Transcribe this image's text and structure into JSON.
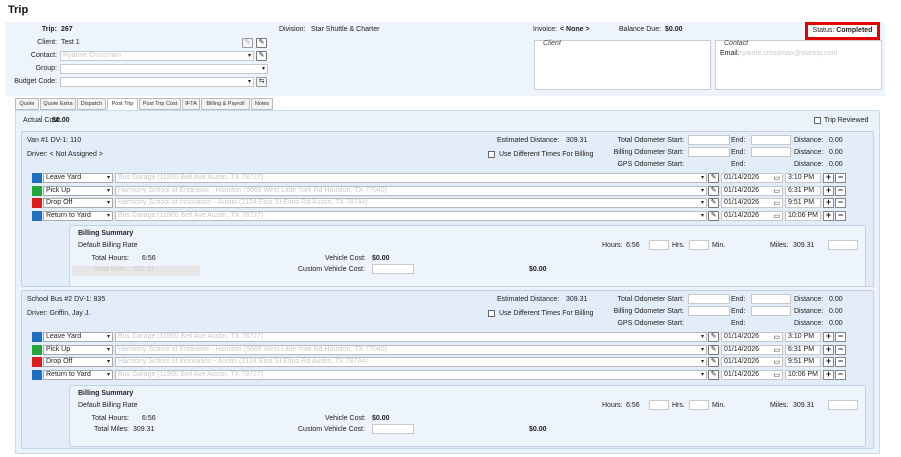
{
  "page": {
    "title": "Trip"
  },
  "header": {
    "trip_label": "Trip:",
    "trip_value": "267",
    "client_label": "Client:",
    "client_value": "Test 1",
    "contact_label": "Contact:",
    "contact_value": "Ryanne Crossman",
    "group_label": "Group:",
    "budget_label": "Budget Code:",
    "division_label": "Division:",
    "division_value": "Star Shuttle & Charter",
    "invoice_label": "Invoice:",
    "invoice_value": "< None >",
    "balance_label": "Balance Due:",
    "balance_value": "$0.00",
    "client_box_label": "Client",
    "contact_box_label": "Contact",
    "email_label": "Email:",
    "email_value": "ryanne.crossman@startrip.com",
    "status_label": "Status:",
    "status_value": "Completed"
  },
  "tabs": [
    "Quote",
    "Quote Extra",
    "Dispatch",
    "Post Trip",
    "Post Trip Cost",
    "IFTA",
    "Billing & Payroll",
    "Notes"
  ],
  "active_tab": "Post Trip",
  "post_trip": {
    "actual_cost_label": "Actual Cost:",
    "actual_cost_value": "$0.00",
    "trip_reviewed_label": "Trip Reviewed"
  },
  "labels": {
    "estimated_distance": "Estimated Distance:",
    "use_diff_times": "Use Different Times For Billing",
    "total_odo_start": "Total Odometer Start:",
    "billing_odo_start": "Billing Odometer Start:",
    "gps_odo_start": "GPS Odometer Start:",
    "end": "End:",
    "distance": "Distance:",
    "billing_summary": "Billing Summary",
    "hours": "Hours:",
    "hrs": "Hrs.",
    "min": "Min.",
    "miles": "Miles:",
    "total_hours": "Total Hours:",
    "total_miles": "Total Miles:",
    "vehicle_cost": "Vehicle Cost:",
    "custom_vehicle_cost": "Custom Vehicle Cost:"
  },
  "vehicles": [
    {
      "title": "Van #1 DV-1: 110",
      "driver": "Driver: < Not Assigned >",
      "estimated_distance": "309.31",
      "distance_total": "0.00",
      "distance_billing": "0.00",
      "distance_gps": "0.00",
      "stops": [
        {
          "type": "Leave Yard",
          "color": "#1f6fc4",
          "address": "Bus Garage (11900 Bell Ave Austin, TX 78727)",
          "date": "01/14/2026",
          "time": "3:10 PM"
        },
        {
          "type": "Pick Up",
          "color": "#22a83a",
          "address": "Harmony School of Endeavor - Houston (9669 West Little York Rd Houston, TX 77040)",
          "date": "01/14/2026",
          "time": "6:31 PM"
        },
        {
          "type": "Drop Off",
          "color": "#dd1c1c",
          "address": "Harmony School of Innovation - Austin (2124 East St Elmo Rd Austin, TX 78744)",
          "date": "01/14/2026",
          "time": "9:51 PM"
        },
        {
          "type": "Return to Yard",
          "color": "#1f6fc4",
          "address": "Bus Garage (11900 Bell Ave Austin, TX 78727)",
          "date": "01/14/2026",
          "time": "10:06 PM"
        }
      ],
      "billing_rate": "Default Billing Rate",
      "hours": "6:56",
      "miles": "309.31",
      "total_hours": "6:56",
      "total_miles": "309.31",
      "vehicle_cost": "$0.00",
      "total_cost": "$0.00",
      "miles_row_faded": true
    },
    {
      "title": "School Bus #2 DV-1: 835",
      "driver": "Driver: Griffin, Jay J.",
      "estimated_distance": "309.31",
      "distance_total": "0.00",
      "distance_billing": "0.00",
      "distance_gps": "0.00",
      "stops": [
        {
          "type": "Leave Yard",
          "color": "#1f6fc4",
          "address": "Bus Garage (11900 Bell Ave Austin, TX 78727)",
          "date": "01/14/2026",
          "time": "3:10 PM"
        },
        {
          "type": "Pick Up",
          "color": "#22a83a",
          "address": "Harmony School of Endeavor - Houston (9669 West Little York Rd Houston, TX 77040)",
          "date": "01/14/2026",
          "time": "6:31 PM"
        },
        {
          "type": "Drop Off",
          "color": "#dd1c1c",
          "address": "Harmony School of Innovation - Austin (2124 East St Elmo Rd Austin, TX 78744)",
          "date": "01/14/2026",
          "time": "9:51 PM"
        },
        {
          "type": "Return to Yard",
          "color": "#1f6fc4",
          "address": "Bus Garage (11900 Bell Ave Austin, TX 78727)",
          "date": "01/14/2026",
          "time": "10:06 PM"
        }
      ],
      "billing_rate": "Default Billing Rate",
      "hours": "6:56",
      "miles": "309.31",
      "total_hours": "6:56",
      "total_miles": "309.31",
      "vehicle_cost": "$0.00",
      "total_cost": "$0.00",
      "miles_row_faded": false
    }
  ],
  "icons": {
    "edit": "pencil-icon",
    "dropdown": "chevron-down-icon",
    "calendar": "calendar-icon",
    "plus": "plus-icon",
    "minus": "minus-icon",
    "share": "share-icon"
  }
}
